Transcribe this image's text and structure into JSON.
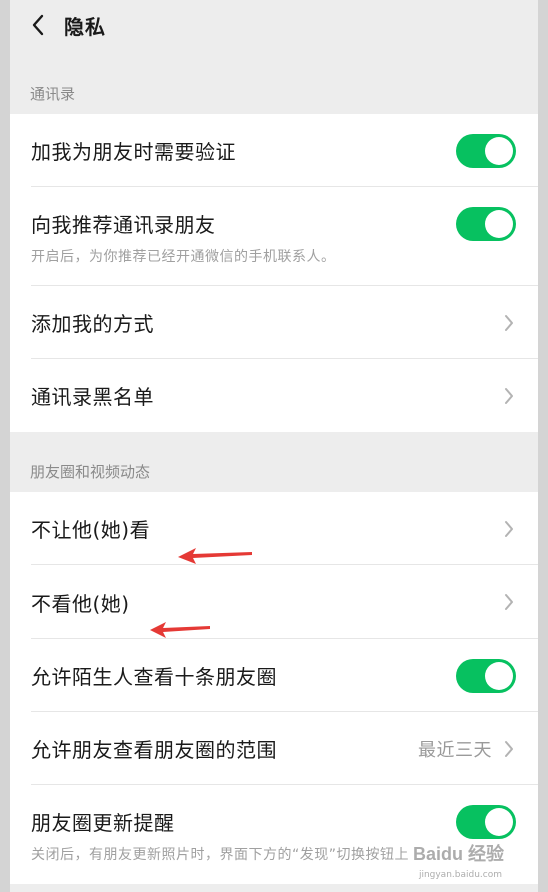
{
  "header": {
    "title": "隐私"
  },
  "sections": {
    "contacts": {
      "label": "通讯录",
      "items": {
        "verify": {
          "label": "加我为朋友时需要验证",
          "toggle": true
        },
        "recommend": {
          "label": "向我推荐通讯录朋友",
          "sub": "开启后，为你推荐已经开通微信的手机联系人。",
          "toggle": true
        },
        "add_methods": {
          "label": "添加我的方式"
        },
        "blacklist": {
          "label": "通讯录黑名单"
        }
      }
    },
    "moments": {
      "label": "朋友圈和视频动态",
      "items": {
        "hide_from": {
          "label": "不让他(她)看"
        },
        "not_see": {
          "label": "不看他(她)"
        },
        "stranger_ten": {
          "label": "允许陌生人查看十条朋友圈",
          "toggle": true
        },
        "range": {
          "label": "允许朋友查看朋友圈的范围",
          "value": "最近三天"
        },
        "update_remind": {
          "label": "朋友圈更新提醒",
          "sub": "关闭后，有朋友更新照片时，界面下方的“发现”切换按钮上",
          "toggle": true
        }
      }
    }
  },
  "watermark": {
    "text": "Baidu 经验",
    "sub": "jingyan.baidu.com"
  },
  "colors": {
    "toggle_on": "#07c160",
    "annotation_arrow": "#e53935"
  }
}
